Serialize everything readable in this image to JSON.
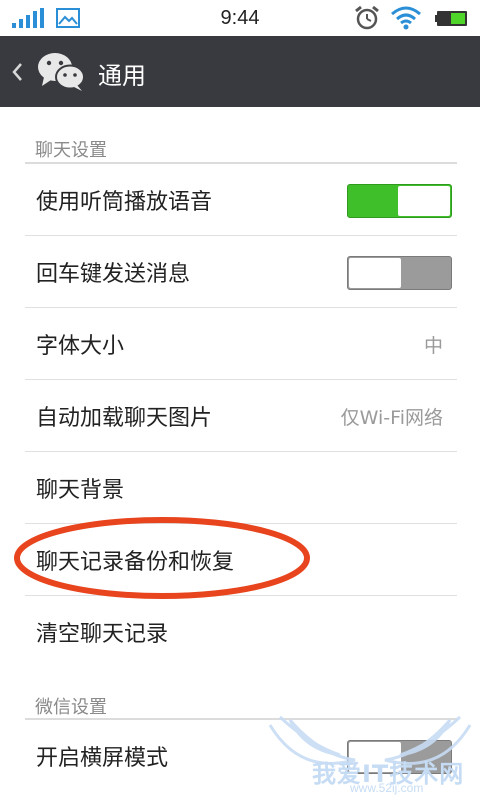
{
  "status_bar": {
    "time": "9:44",
    "icons": [
      "signal-icon",
      "gallery-icon",
      "alarm-icon",
      "wifi-icon",
      "battery-icon"
    ]
  },
  "header": {
    "title": "通用",
    "icons": [
      "back-icon",
      "wechat-icon"
    ],
    "background": "#393a3f"
  },
  "sections": [
    {
      "title": "聊天设置",
      "rows": [
        {
          "label": "使用听筒播放语音",
          "control": "toggle",
          "on": true
        },
        {
          "label": "回车键发送消息",
          "control": "toggle",
          "on": false
        },
        {
          "label": "字体大小",
          "value": "中"
        },
        {
          "label": "自动加载聊天图片",
          "value": "仅Wi-Fi网络"
        },
        {
          "label": "聊天背景"
        },
        {
          "label": "聊天记录备份和恢复",
          "highlighted": true
        },
        {
          "label": "清空聊天记录"
        }
      ]
    },
    {
      "title": "微信设置",
      "rows": [
        {
          "label": "开启横屏模式",
          "control": "toggle",
          "on": false
        }
      ]
    }
  ],
  "colors": {
    "toggle_on": "#3fbf2a",
    "toggle_off": "#9b9b9b",
    "highlight_ellipse": "#e8451e"
  },
  "watermark": {
    "text": "我爱IT技术网",
    "url": "www.52ij.com"
  }
}
